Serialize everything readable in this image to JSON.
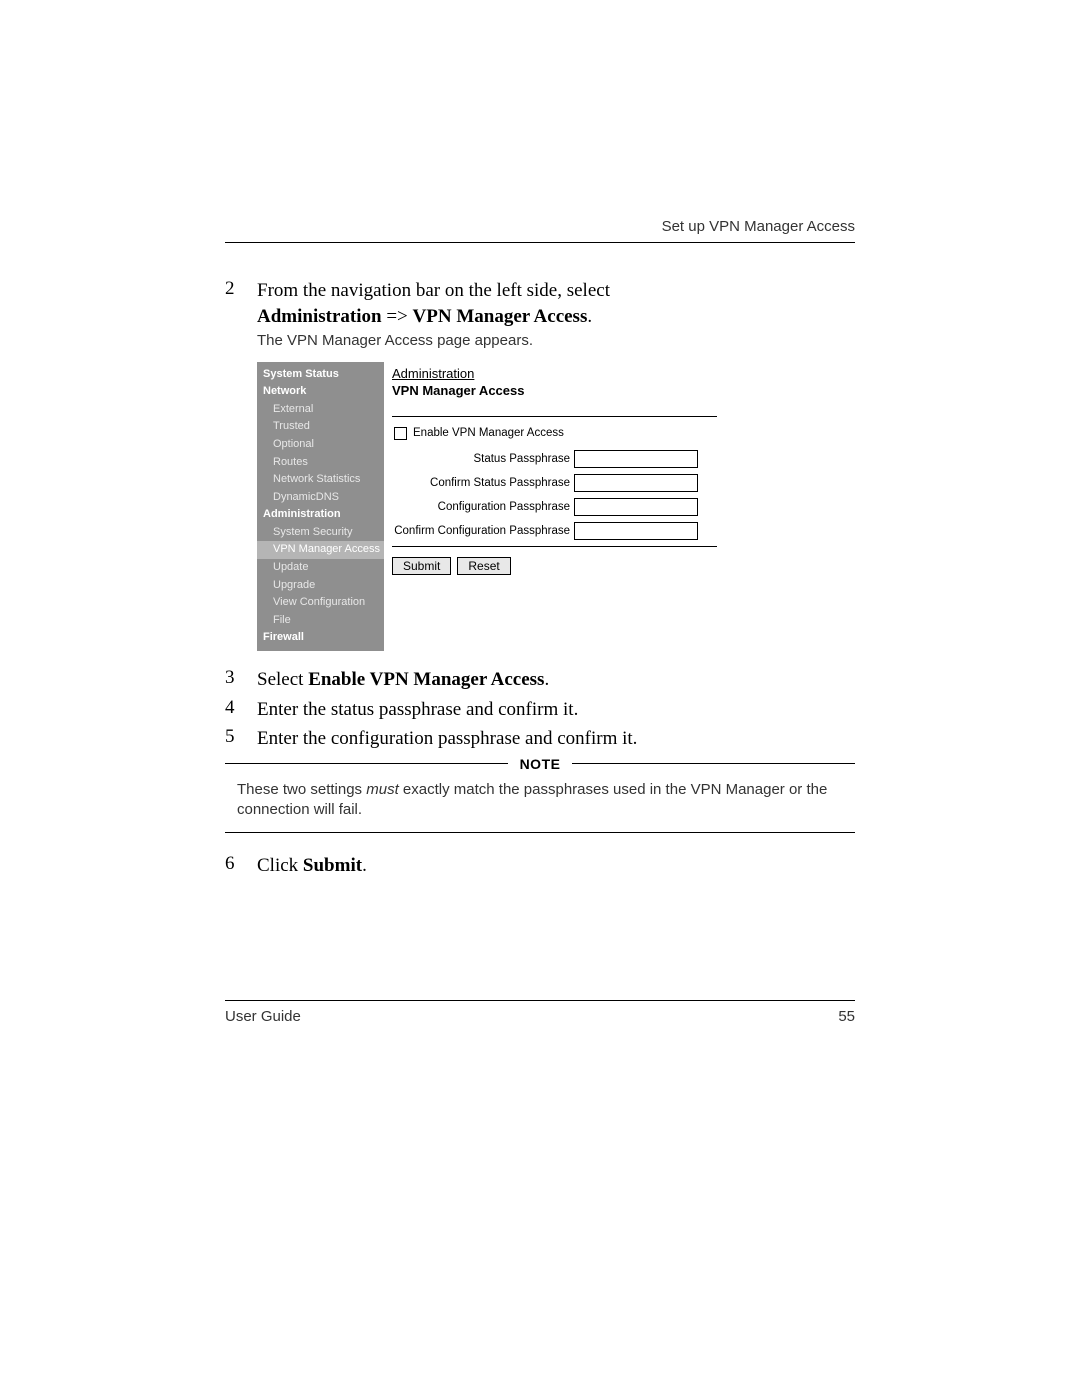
{
  "header": {
    "right": "Set up VPN Manager Access"
  },
  "steps": {
    "s2": {
      "num": "2",
      "line1a": "From the navigation bar on the left side, select ",
      "line2_bold1": "Administration ",
      "line2_arrow": "=> ",
      "line2_bold2": "VPN Manager Access",
      "line2_end": ".",
      "sub": "The VPN Manager Access page appears."
    },
    "s3": {
      "num": "3",
      "pre": "Select ",
      "bold": "Enable VPN Manager Access",
      "post": "."
    },
    "s4": {
      "num": "4",
      "text": "Enter the status passphrase and confirm it."
    },
    "s5": {
      "num": "5",
      "text": "Enter the configuration passphrase and confirm it."
    },
    "s6": {
      "num": "6",
      "pre": "Click ",
      "bold": "Submit",
      "post": "."
    }
  },
  "screenshot": {
    "sidebar": {
      "system_status": "System Status",
      "network": "Network",
      "external": "External",
      "trusted": "Trusted",
      "optional": "Optional",
      "routes": "Routes",
      "netstats": "Network Statistics",
      "dyndns": "DynamicDNS",
      "administration": "Administration",
      "syssec": "System Security",
      "vpnmgr": "VPN Manager Access",
      "update": "Update",
      "upgrade": "Upgrade",
      "viewcfg": "View Configuration File",
      "firewall": "Firewall"
    },
    "main": {
      "crumb": "Administration",
      "title": "VPN Manager Access",
      "enable": "Enable VPN Manager Access",
      "status_pass": "Status Passphrase",
      "confirm_status": "Confirm Status Passphrase",
      "config_pass": "Configuration Passphrase",
      "confirm_config": "Confirm Configuration Passphrase",
      "submit": "Submit",
      "reset": "Reset"
    }
  },
  "note": {
    "label": "NOTE",
    "p1a": "These two settings ",
    "p1_ital": "must",
    "p1b": " exactly match the passphrases used in the VPN Manager or the connection will fail."
  },
  "footer": {
    "left": "User Guide",
    "right": "55"
  }
}
